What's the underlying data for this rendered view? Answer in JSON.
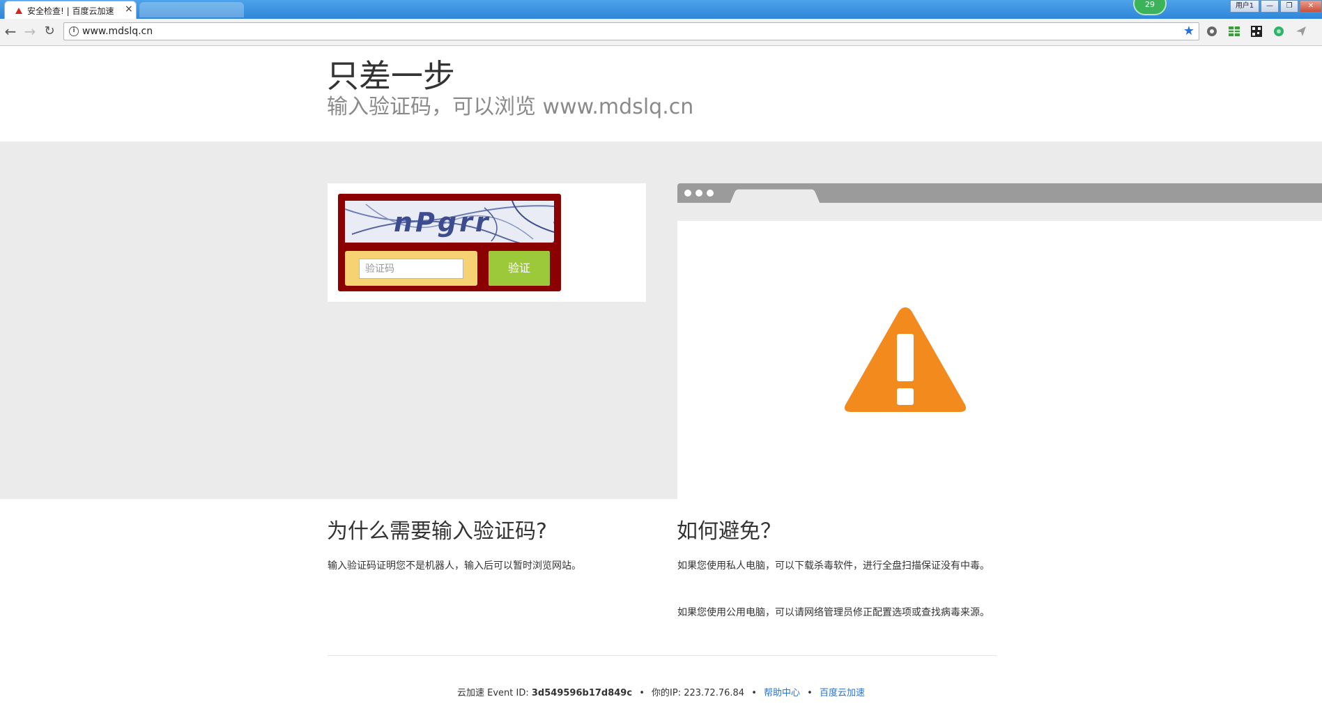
{
  "browser": {
    "tab_title": "安全检查! | 百度云加速",
    "tab_close": "×",
    "badge_count": "29",
    "window_controls": [
      "用户1",
      "—",
      "❐",
      "✕"
    ],
    "url": "www.mdslq.cn"
  },
  "header": {
    "title": "只差一步",
    "subtitle": "输入验证码，可以浏览 www.mdslq.cn"
  },
  "captcha": {
    "image_text": "nPgrr",
    "input_placeholder": "验证码",
    "input_value": "",
    "submit_label": "验证"
  },
  "why": {
    "heading": "为什么需要输入验证码?",
    "text": "输入验证码证明您不是机器人，输入后可以暂时浏览网站。"
  },
  "avoid": {
    "heading": "如何避免？",
    "para1": "如果您使用私人电脑，可以下载杀毒软件，进行全盘扫描保证没有中毒。",
    "para2": "如果您使用公用电脑，可以请网络管理员修正配置选项或查找病毒来源。"
  },
  "footer": {
    "service": "云加速",
    "event_label": "Event ID:",
    "event_id": "3d549596b17d849c",
    "ip_label": "你的IP:",
    "ip": "223.72.76.84",
    "help_link": "帮助中心",
    "brand_link": "百度云加速",
    "bullet": "•"
  },
  "colors": {
    "captcha_frame": "#8b0000",
    "captcha_input_bg": "#f6d273",
    "verify_button": "#9cc93a",
    "warning": "#f28a1e",
    "link": "#2f73c8"
  }
}
